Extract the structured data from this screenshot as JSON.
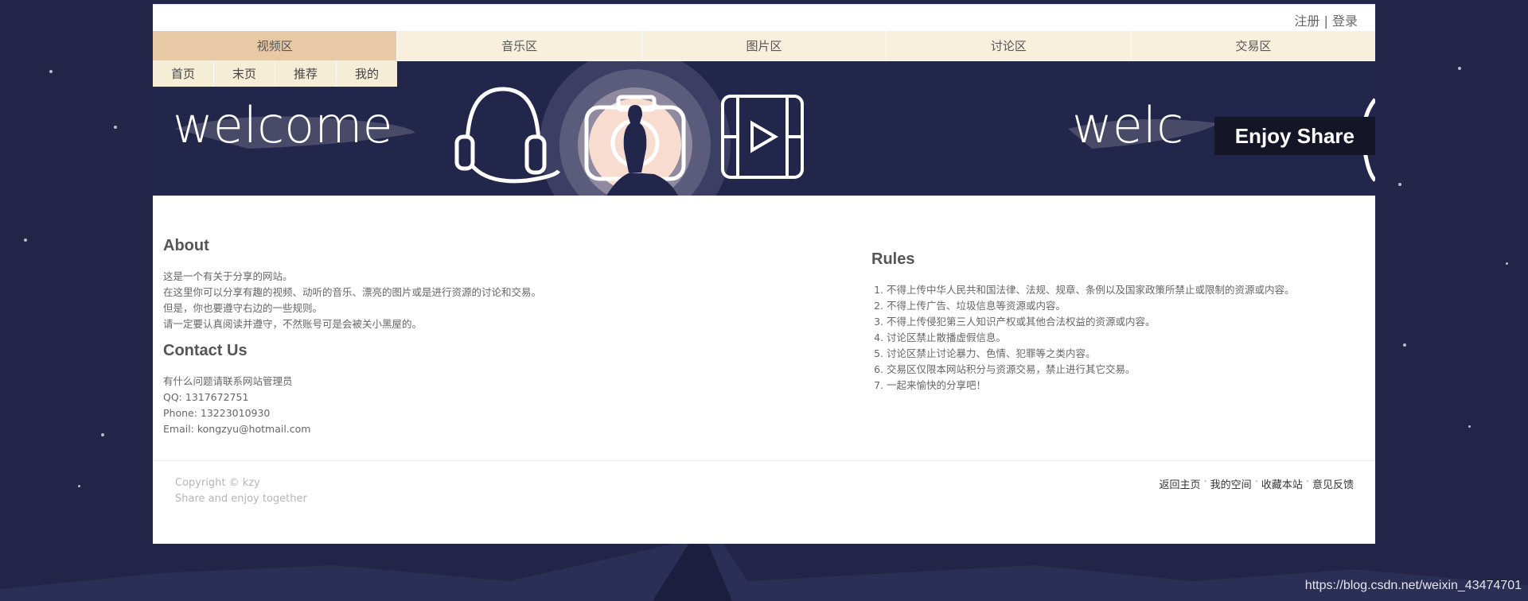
{
  "auth": {
    "register": "注册",
    "separator": "|",
    "login": "登录"
  },
  "nav": {
    "tabs": [
      {
        "label": "视频区",
        "active": true
      },
      {
        "label": "音乐区"
      },
      {
        "label": "图片区"
      },
      {
        "label": "讨论区"
      },
      {
        "label": "交易区"
      }
    ],
    "sub": [
      "首页",
      "末页",
      "推荐",
      "我的"
    ]
  },
  "banner": {
    "welcome_text": "welcome",
    "welcome_text_partial": "welc",
    "enjoy": "Enjoy Share",
    "icons": [
      "headphones-icon",
      "camera-icon",
      "film-play-icon"
    ]
  },
  "about": {
    "title": "About",
    "lines": [
      "这是一个有关于分享的网站。",
      "在这里你可以分享有趣的视频、动听的音乐、漂亮的图片或是进行资源的讨论和交易。",
      "但是，你也要遵守右边的一些规则。",
      "请一定要认真阅读并遵守，不然账号可是会被关小黑屋的。"
    ]
  },
  "contact": {
    "title": "Contact Us",
    "lines": [
      "有什么问题请联系网站管理员",
      "QQ: 1317672751",
      "Phone: 13223010930",
      "Email: kongzyu@hotmail.com"
    ]
  },
  "rules": {
    "title": "Rules",
    "items": [
      "不得上传中华人民共和国法律、法规、规章、条例以及国家政策所禁止或限制的资源或内容。",
      "不得上传广告、垃圾信息等资源或内容。",
      "不得上传侵犯第三人知识产权或其他合法权益的资源或内容。",
      "讨论区禁止散播虚假信息。",
      "讨论区禁止讨论暴力、色情、犯罪等之类内容。",
      "交易区仅限本网站积分与资源交易，禁止进行其它交易。",
      "一起来愉快的分享吧！"
    ]
  },
  "footer": {
    "copyright": "Copyright © kzy",
    "tagline": "Share and enjoy together",
    "links": [
      "返回主页",
      "我的空间",
      "收藏本站",
      "意见反馈"
    ],
    "separator": "·"
  },
  "watermark": "https://blog.csdn.net/weixin_43474701",
  "colors": {
    "background": "#222448",
    "nav_tab": "#f8f0dd",
    "nav_active": "#e8c9a6",
    "banner": "#23264b"
  }
}
